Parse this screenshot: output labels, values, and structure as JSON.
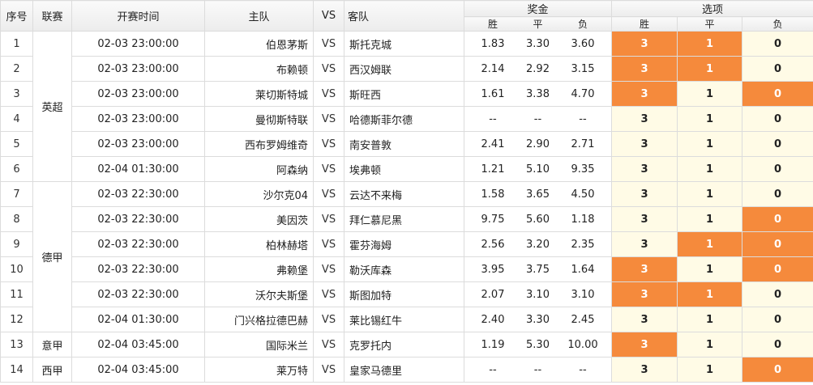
{
  "headers": {
    "index": "序号",
    "league": "联赛",
    "time": "开赛时间",
    "home": "主队",
    "vs": "VS",
    "away": "客队",
    "prize": "奖金",
    "options": "选项",
    "win": "胜",
    "draw": "平",
    "lose": "负"
  },
  "rows": [
    {
      "idx": "1",
      "time": "02-03 23:00:00",
      "home": "伯恩茅斯",
      "vs": "VS",
      "away": "斯托克城",
      "o": [
        "1.83",
        "3.30",
        "3.60"
      ],
      "opt": [
        "3",
        "1",
        "0"
      ],
      "sel": [
        true,
        true,
        false
      ]
    },
    {
      "idx": "2",
      "time": "02-03 23:00:00",
      "home": "布赖顿",
      "vs": "VS",
      "away": "西汉姆联",
      "o": [
        "2.14",
        "2.92",
        "3.15"
      ],
      "opt": [
        "3",
        "1",
        "0"
      ],
      "sel": [
        true,
        true,
        false
      ]
    },
    {
      "idx": "3",
      "time": "02-03 23:00:00",
      "home": "莱切斯特城",
      "vs": "VS",
      "away": "斯旺西",
      "o": [
        "1.61",
        "3.38",
        "4.70"
      ],
      "opt": [
        "3",
        "1",
        "0"
      ],
      "sel": [
        true,
        false,
        true
      ]
    },
    {
      "idx": "4",
      "time": "02-03 23:00:00",
      "home": "曼彻斯特联",
      "vs": "VS",
      "away": "哈德斯菲尔德",
      "o": [
        "--",
        "--",
        "--"
      ],
      "opt": [
        "3",
        "1",
        "0"
      ],
      "sel": [
        false,
        false,
        false
      ]
    },
    {
      "idx": "5",
      "time": "02-03 23:00:00",
      "home": "西布罗姆维奇",
      "vs": "VS",
      "away": "南安普敦",
      "o": [
        "2.41",
        "2.90",
        "2.71"
      ],
      "opt": [
        "3",
        "1",
        "0"
      ],
      "sel": [
        false,
        false,
        false
      ]
    },
    {
      "idx": "6",
      "time": "02-04 01:30:00",
      "home": "阿森纳",
      "vs": "VS",
      "away": "埃弗顿",
      "o": [
        "1.21",
        "5.10",
        "9.35"
      ],
      "opt": [
        "3",
        "1",
        "0"
      ],
      "sel": [
        false,
        false,
        false
      ]
    },
    {
      "idx": "7",
      "time": "02-03 22:30:00",
      "home": "沙尔克04",
      "vs": "VS",
      "away": "云达不来梅",
      "o": [
        "1.58",
        "3.65",
        "4.50"
      ],
      "opt": [
        "3",
        "1",
        "0"
      ],
      "sel": [
        false,
        false,
        false
      ]
    },
    {
      "idx": "8",
      "time": "02-03 22:30:00",
      "home": "美因茨",
      "vs": "VS",
      "away": "拜仁慕尼黑",
      "o": [
        "9.75",
        "5.60",
        "1.18"
      ],
      "opt": [
        "3",
        "1",
        "0"
      ],
      "sel": [
        false,
        false,
        true
      ]
    },
    {
      "idx": "9",
      "time": "02-03 22:30:00",
      "home": "柏林赫塔",
      "vs": "VS",
      "away": "霍芬海姆",
      "o": [
        "2.56",
        "3.20",
        "2.35"
      ],
      "opt": [
        "3",
        "1",
        "0"
      ],
      "sel": [
        false,
        true,
        true
      ]
    },
    {
      "idx": "10",
      "time": "02-03 22:30:00",
      "home": "弗赖堡",
      "vs": "VS",
      "away": "勒沃库森",
      "o": [
        "3.95",
        "3.75",
        "1.64"
      ],
      "opt": [
        "3",
        "1",
        "0"
      ],
      "sel": [
        true,
        false,
        true
      ]
    },
    {
      "idx": "11",
      "time": "02-03 22:30:00",
      "home": "沃尔夫斯堡",
      "vs": "VS",
      "away": "斯图加特",
      "o": [
        "2.07",
        "3.10",
        "3.10"
      ],
      "opt": [
        "3",
        "1",
        "0"
      ],
      "sel": [
        true,
        true,
        false
      ]
    },
    {
      "idx": "12",
      "time": "02-04 01:30:00",
      "home": "门兴格拉德巴赫",
      "vs": "VS",
      "away": "莱比锡红牛",
      "o": [
        "2.40",
        "3.30",
        "2.45"
      ],
      "opt": [
        "3",
        "1",
        "0"
      ],
      "sel": [
        false,
        false,
        false
      ]
    },
    {
      "idx": "13",
      "time": "02-04 03:45:00",
      "home": "国际米兰",
      "vs": "VS",
      "away": "克罗托内",
      "o": [
        "1.19",
        "5.30",
        "10.00"
      ],
      "opt": [
        "3",
        "1",
        "0"
      ],
      "sel": [
        true,
        false,
        false
      ]
    },
    {
      "idx": "14",
      "time": "02-04 03:45:00",
      "home": "莱万特",
      "vs": "VS",
      "away": "皇家马德里",
      "o": [
        "--",
        "--",
        "--"
      ],
      "opt": [
        "3",
        "1",
        "0"
      ],
      "sel": [
        false,
        false,
        true
      ]
    }
  ],
  "leagues": [
    {
      "name": "英超",
      "rows": 6
    },
    {
      "name": "德甲",
      "rows": 6
    },
    {
      "name": "意甲",
      "rows": 1
    },
    {
      "name": "西甲",
      "rows": 1
    }
  ],
  "colors": {
    "selected": "#f58a3c",
    "option_bg": "#fffbe6",
    "border": "#dcdcdc"
  }
}
